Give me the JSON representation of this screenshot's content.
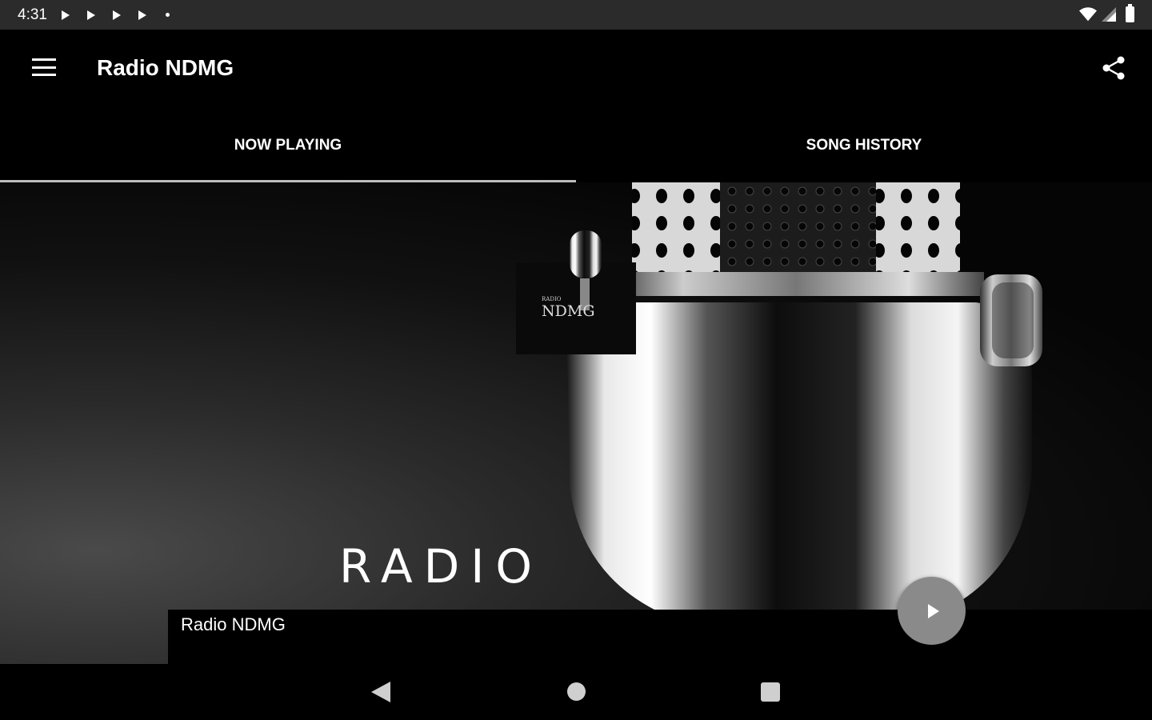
{
  "status_bar": {
    "time": "4:31",
    "notification_icons": [
      "play-icon",
      "play-icon",
      "play-icon",
      "play-icon",
      "dot-icon"
    ],
    "right_icons": [
      "wifi-icon",
      "signal-icon",
      "battery-icon"
    ]
  },
  "app_bar": {
    "title": "Radio NDMG",
    "left_icon": "menu-icon",
    "right_icon": "share-icon"
  },
  "tabs": [
    {
      "label": "NOW PLAYING",
      "active": true
    },
    {
      "label": "SONG HISTORY",
      "active": false
    }
  ],
  "artwork": {
    "headline": "RADIO",
    "logo_text": "NDMG",
    "logo_small_text": "RADIO"
  },
  "player": {
    "station_name": "Radio NDMG",
    "button_icon": "play-icon"
  },
  "nav_bar": {
    "icons": [
      "back-icon",
      "home-icon",
      "recents-icon"
    ]
  },
  "colors": {
    "background": "#000000",
    "status_bar": "#2b2b2b",
    "tab_indicator": "#bdbdbd",
    "play_button": "#8a8a8a"
  }
}
